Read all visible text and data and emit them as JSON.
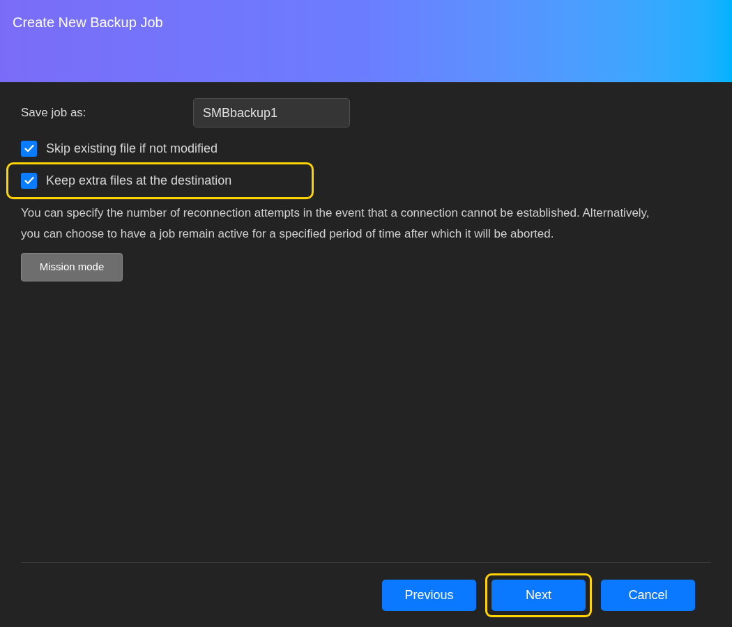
{
  "window": {
    "title": "Create New Backup Job"
  },
  "job_name": {
    "label": "Save job as:",
    "value": "SMBbackup1"
  },
  "options": [
    {
      "label": "Skip existing file if not modified",
      "checked": true,
      "highlighted": false
    },
    {
      "label": "Keep extra files at the destination",
      "checked": true,
      "highlighted": true
    }
  ],
  "description": "You can specify the number of reconnection attempts in the event that a connection cannot be established. Alternatively, you can choose to have a job remain active for a specified period of time after which it will be aborted.",
  "mission_button": {
    "label": "Mission mode"
  },
  "footer_buttons": [
    {
      "label": "Previous",
      "highlighted": false
    },
    {
      "label": "Next",
      "highlighted": true
    },
    {
      "label": "Cancel",
      "highlighted": false
    }
  ]
}
